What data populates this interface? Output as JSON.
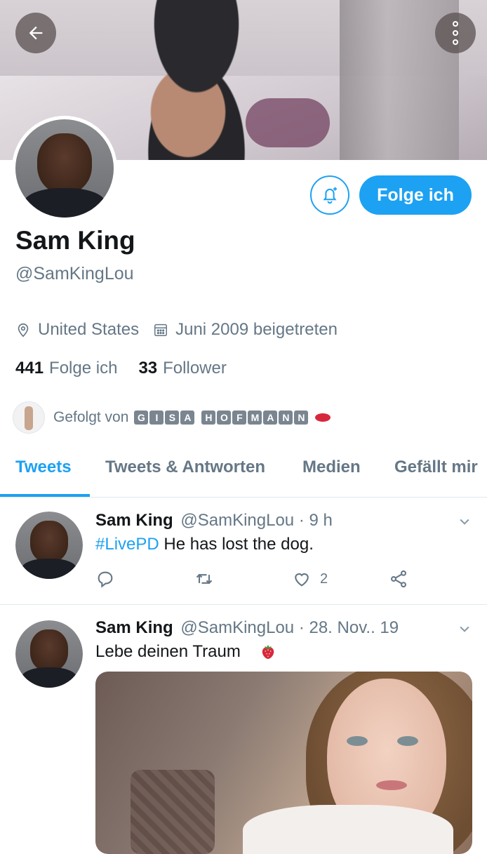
{
  "profile": {
    "name": "Sam King",
    "handle": "@SamKingLou",
    "location": "United States",
    "joined": "Juni 2009 beigetreten",
    "following_count": "441",
    "following_label": "Folge ich",
    "followers_count": "33",
    "followers_label": "Follower",
    "follow_button_label": "Folge ich"
  },
  "followed_by": {
    "prefix": "Gefolgt von",
    "name_boxed": "GISA HOFMANN"
  },
  "tabs": [
    {
      "label": "Tweets",
      "active": true
    },
    {
      "label": "Tweets & Antworten",
      "active": false
    },
    {
      "label": "Medien",
      "active": false
    },
    {
      "label": "Gefällt mir",
      "active": false
    }
  ],
  "tweets": [
    {
      "name": "Sam King",
      "handle": "@SamKingLou",
      "time": "· 9 h",
      "hashtag": "#LivePD",
      "text": "He has lost the dog.",
      "like_count": "2"
    },
    {
      "name": "Sam King",
      "handle": "@SamKingLou",
      "time": "· 28. Nov.. 19",
      "text": "Lebe deinen Traum",
      "emoji": "strawberry"
    }
  ],
  "colors": {
    "accent": "#1da1f2",
    "secondary_text": "#657786",
    "primary_text": "#14171a",
    "divider": "#e1e8ed"
  },
  "icons": [
    "back-arrow-icon",
    "more-options-icon",
    "bell-plus-icon",
    "location-pin-icon",
    "calendar-icon",
    "reply-icon",
    "retweet-icon",
    "heart-icon",
    "share-icon",
    "chevron-down-icon",
    "strawberry-emoji",
    "lips-emoji"
  ]
}
